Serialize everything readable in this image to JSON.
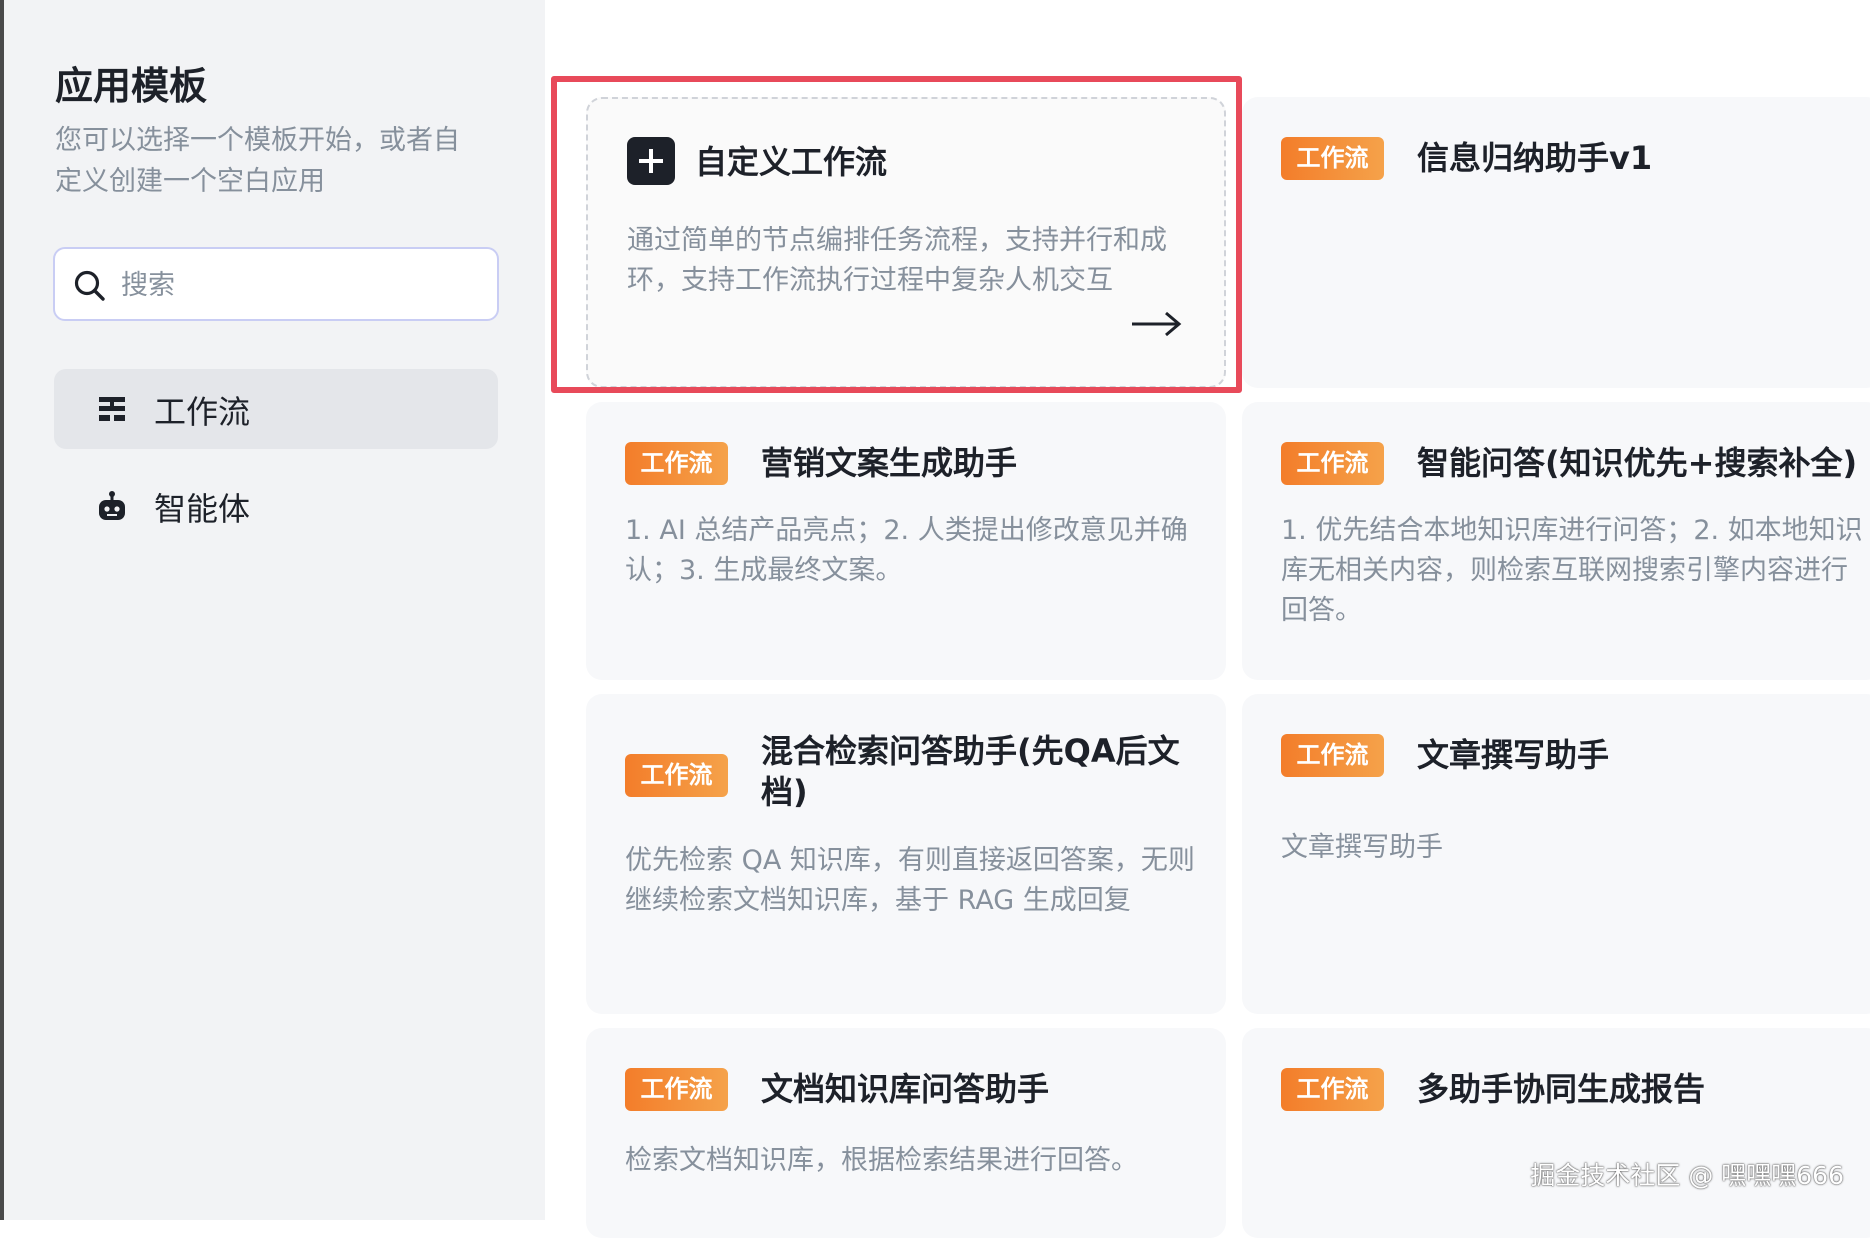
{
  "sidebar": {
    "title": "应用模板",
    "description": "您可以选择一个模板开始，或者自定义创建一个空白应用",
    "search": {
      "placeholder": "搜索",
      "value": ""
    },
    "items": [
      {
        "label": "工作流",
        "icon": "workflow-icon",
        "active": true
      },
      {
        "label": "智能体",
        "icon": "robot-icon",
        "active": false
      }
    ]
  },
  "custom_card": {
    "icon": "plus-icon",
    "title": "自定义工作流",
    "description": "通过简单的节点编排任务流程，支持并行和成环，支持工作流执行过程中复杂人机交互",
    "arrow_icon": "arrow-right-icon"
  },
  "templates": [
    {
      "tag": "工作流",
      "title": "信息归纳助手v1",
      "description": ""
    },
    {
      "tag": "工作流",
      "title": "营销文案生成助手",
      "description": "1. AI 总结产品亮点；2. 人类提出修改意见并确认；3. 生成最终文案。"
    },
    {
      "tag": "工作流",
      "title": "智能问答(知识优先+搜索补全)",
      "description": "1. 优先结合本地知识库进行问答；2. 如本地知识库无相关内容，则检索互联网搜索引擎内容进行回答。"
    },
    {
      "tag": "工作流",
      "title": "混合检索问答助手(先QA后文档)",
      "description": "优先检索 QA 知识库，有则直接返回答案，无则继续检索文档知识库，基于 RAG 生成回复"
    },
    {
      "tag": "工作流",
      "title": "文章撰写助手",
      "description": "文章撰写助手"
    },
    {
      "tag": "工作流",
      "title": "文档知识库问答助手",
      "description": "检索文档知识库，根据检索结果进行回答。"
    },
    {
      "tag": "工作流",
      "title": "多助手协同生成报告",
      "description": ""
    }
  ],
  "colors": {
    "highlight": "#e84a5a",
    "tag_gradient_start": "#f37d2a",
    "tag_gradient_end": "#f5a24a"
  },
  "watermark": "掘金技术社区 @ 嘿嘿嘿666"
}
